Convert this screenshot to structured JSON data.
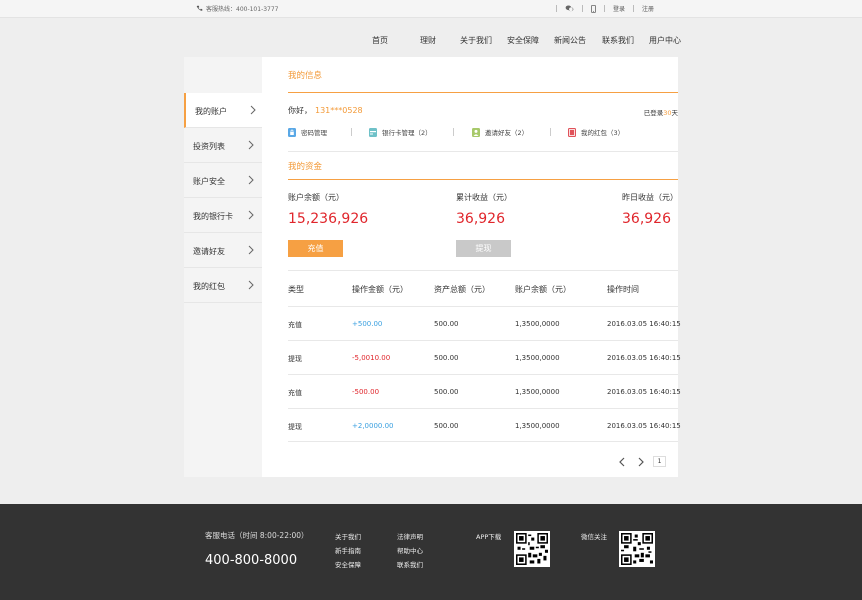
{
  "topbar": {
    "hotline": "客服热线：400-101-3777",
    "login": "登录",
    "register": "注册"
  },
  "nav": [
    "首页",
    "理财",
    "关于我们",
    "安全保障",
    "新闻公告",
    "联系我们",
    "用户中心"
  ],
  "sidebar": {
    "items": [
      {
        "label": "我的账户"
      },
      {
        "label": "投资列表"
      },
      {
        "label": "账户安全"
      },
      {
        "label": "我的银行卡"
      },
      {
        "label": "邀请好友"
      },
      {
        "label": "我的红包"
      }
    ]
  },
  "info": {
    "title": "我的信息",
    "greeting": "你好，",
    "phone": "131***0528",
    "logged_prefix": "已登录",
    "logged_days": "30",
    "logged_suffix": "天",
    "links": [
      {
        "label": "密码管理",
        "icon": "lock-icon",
        "color": "#5aa8e6"
      },
      {
        "label": "银行卡管理（2）",
        "icon": "card-icon",
        "color": "#6fc1c8"
      },
      {
        "label": "邀请好友（2）",
        "icon": "friend-icon",
        "color": "#a7c96a"
      },
      {
        "label": "我的红包（3）",
        "icon": "redpacket-icon",
        "color": "#e0525a"
      }
    ]
  },
  "funds": {
    "title": "我的资金",
    "balance_label": "账户余额（元）",
    "balance_value": "15,236,926",
    "total_label": "累计收益（元）",
    "total_value": "36,926",
    "yesterday_label": "昨日收益（元）",
    "yesterday_value": "36,926",
    "recharge": "充值",
    "withdraw": "提现"
  },
  "table": {
    "headers": [
      "类型",
      "操作金额（元）",
      "资产总额（元）",
      "账户余额（元）",
      "操作时间"
    ],
    "rows": [
      {
        "type": "充值",
        "amount": "+500.00",
        "kind": "plus",
        "total": "500.00",
        "balance": "1,3500,0000",
        "time": "2016.03.05   16:40:15"
      },
      {
        "type": "提现",
        "amount": "-5,0010.00",
        "kind": "minus",
        "total": "500.00",
        "balance": "1,3500,0000",
        "time": "2016.03.05   16:40:15"
      },
      {
        "type": "充值",
        "amount": "-500.00",
        "kind": "minus",
        "total": "500.00",
        "balance": "1,3500,0000",
        "time": "2016.03.05   16:40:15"
      },
      {
        "type": "提现",
        "amount": "+2,0000.00",
        "kind": "plus",
        "total": "500.00",
        "balance": "1,3500,0000",
        "time": "2016.03.05   16:40:15"
      }
    ]
  },
  "pager": {
    "page": "1"
  },
  "footer": {
    "hotline": "客服电话（时间 8:00-22:00）",
    "number": "400-800-8000",
    "col1": [
      "关于我们",
      "新手指南",
      "安全保障"
    ],
    "col2": [
      "法律声明",
      "帮助中心",
      "联系我们"
    ],
    "app": "APP下载",
    "wechat": "微信关注"
  }
}
